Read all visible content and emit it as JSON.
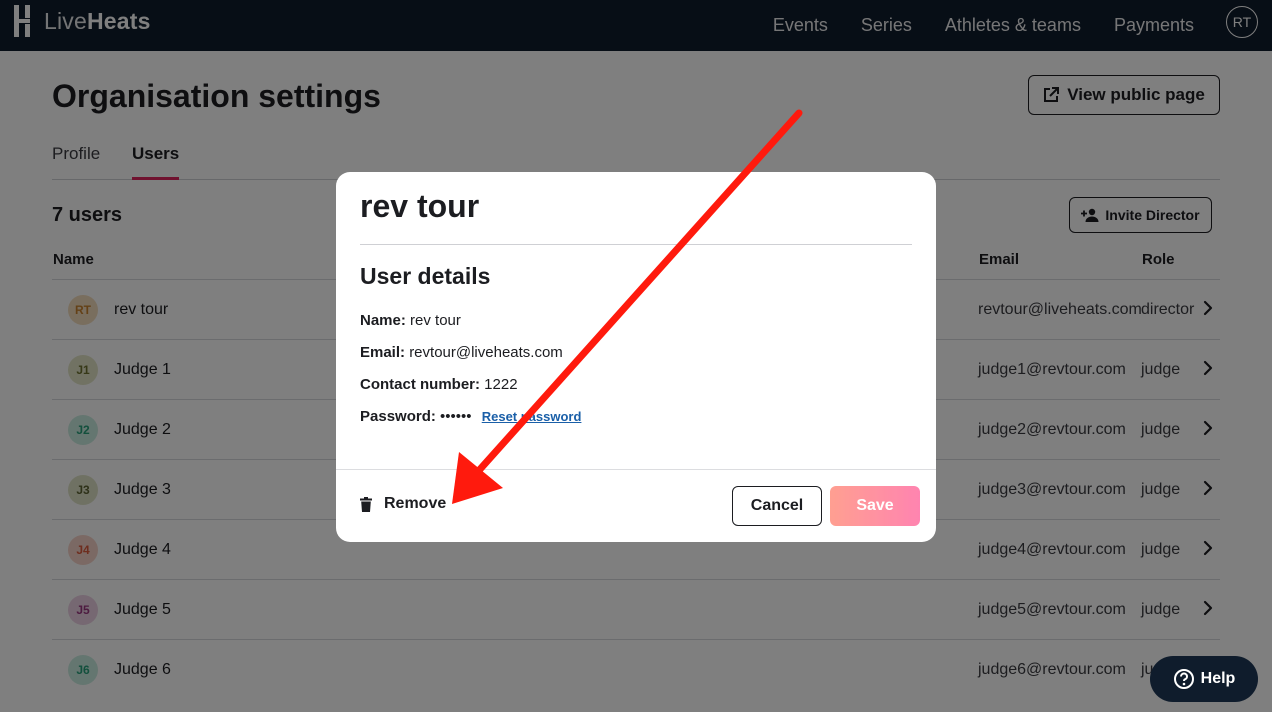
{
  "brand": {
    "name_light": "Live",
    "name_bold": "Heats"
  },
  "nav": {
    "links": [
      "Events",
      "Series",
      "Athletes & teams",
      "Payments"
    ],
    "avatar_initials": "RT"
  },
  "page": {
    "title": "Organisation settings",
    "view_public_label": "View public page",
    "tabs": [
      "Profile",
      "Users"
    ],
    "active_tab": "Users"
  },
  "users": {
    "count_label": "7 users",
    "invite_label": "Invite Director",
    "columns": {
      "name": "Name",
      "email": "Email",
      "role": "Role"
    },
    "rows": [
      {
        "initials": "RT",
        "name": "rev tour",
        "email": "revtour@liveheats.com",
        "role": "director",
        "avatar_bg": "#f3dcbd",
        "avatar_fg": "#c9822f"
      },
      {
        "initials": "J1",
        "name": "Judge 1",
        "email": "judge1@revtour.com",
        "role": "judge",
        "avatar_bg": "#e2e5c6",
        "avatar_fg": "#6e7330"
      },
      {
        "initials": "J2",
        "name": "Judge 2",
        "email": "judge2@revtour.com",
        "role": "judge",
        "avatar_bg": "#c9ece0",
        "avatar_fg": "#27a07a"
      },
      {
        "initials": "J3",
        "name": "Judge 3",
        "email": "judge3@revtour.com",
        "role": "judge",
        "avatar_bg": "#dfe3c6",
        "avatar_fg": "#5c6332"
      },
      {
        "initials": "J4",
        "name": "Judge 4",
        "email": "judge4@revtour.com",
        "role": "judge",
        "avatar_bg": "#f6d3c8",
        "avatar_fg": "#dd5a3c"
      },
      {
        "initials": "J5",
        "name": "Judge 5",
        "email": "judge5@revtour.com",
        "role": "judge",
        "avatar_bg": "#ecd0e4",
        "avatar_fg": "#9a3680"
      },
      {
        "initials": "J6",
        "name": "Judge 6",
        "email": "judge6@revtour.com",
        "role": "judge",
        "avatar_bg": "#c9ece0",
        "avatar_fg": "#27a07a"
      }
    ]
  },
  "modal": {
    "title": "rev tour",
    "section_title": "User details",
    "name_label": "Name:",
    "name_value": "rev tour",
    "email_label": "Email:",
    "email_value": "revtour@liveheats.com",
    "contact_label": "Contact number:",
    "contact_value": "1222",
    "password_label": "Password:",
    "password_value": "••••••",
    "reset_label": "Reset password",
    "remove_label": "Remove",
    "cancel_label": "Cancel",
    "save_label": "Save"
  },
  "help": {
    "label": "Help"
  },
  "colors": {
    "nav_bg": "#0f1c2c",
    "accent": "#e0245e",
    "annotation_arrow": "#ff0000",
    "link": "#1a5fa8"
  },
  "icons": {
    "logo": "liveheats-logo-icon",
    "external": "external-link-icon",
    "add_user": "add-user-icon",
    "chevron": "chevron-right-icon",
    "trash": "trash-icon",
    "help": "question-circle-icon"
  }
}
